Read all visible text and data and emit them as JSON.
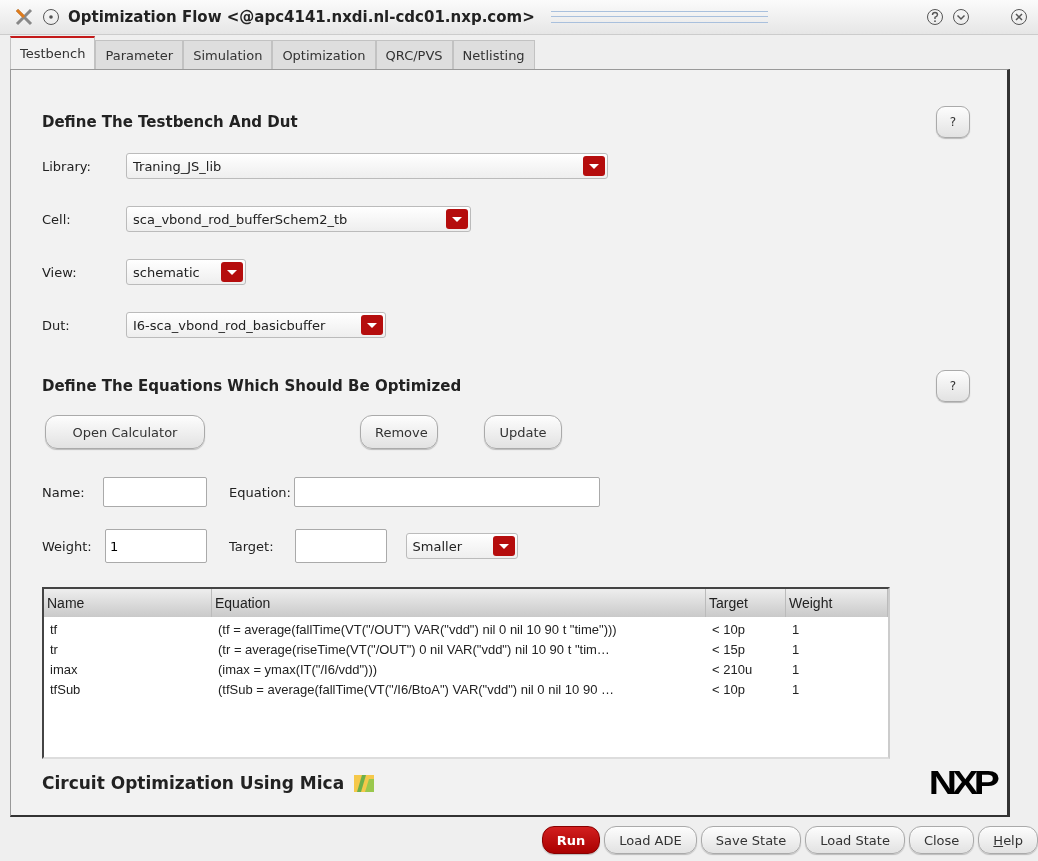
{
  "window": {
    "title": "Optimization Flow <@apc4141.nxdi.nl-cdc01.nxp.com>"
  },
  "tabs": [
    {
      "label": "Testbench",
      "selected": true
    },
    {
      "label": "Parameter",
      "selected": false
    },
    {
      "label": "Simulation",
      "selected": false
    },
    {
      "label": "Optimization",
      "selected": false
    },
    {
      "label": "QRC/PVS",
      "selected": false
    },
    {
      "label": "Netlisting",
      "selected": false
    }
  ],
  "testbench_section": {
    "title": "Define The Testbench And Dut",
    "help": "?",
    "fields": [
      {
        "label": "Library:",
        "value": "Traning_JS_lib"
      },
      {
        "label": "Cell:",
        "value": "sca_vbond_rod_bufferSchem2_tb"
      },
      {
        "label": "View:",
        "value": "schematic"
      },
      {
        "label": "Dut:",
        "value": "I6-sca_vbond_rod_basicbuffer"
      }
    ]
  },
  "equations_section": {
    "title": "Define The Equations Which Should Be Optimized",
    "help": "?",
    "buttons": [
      "Open Calculator",
      "Remove",
      "Update"
    ],
    "name": {
      "label": "Name:"
    },
    "equation": {
      "label": "Equation:"
    },
    "weight": {
      "label": "Weight:",
      "value": "1"
    },
    "target": {
      "label": "Target:"
    },
    "direction": {
      "value": "Smaller"
    }
  },
  "table": {
    "columns": [
      "Name",
      "Equation",
      "Target",
      "Weight"
    ],
    "rows": [
      [
        "tf",
        "(tf = average(fallTime(VT(\"/OUT\") VAR(\"vdd\") nil 0 nil 10 90 t \"time\")))",
        "< 10p",
        "1"
      ],
      [
        "tr",
        "(tr = average(riseTime(VT(\"/OUT\") 0 nil VAR(\"vdd\") nil 10 90 t \"tim…",
        "< 15p",
        "1"
      ],
      [
        "imax",
        "(imax = ymax(IT(\"/I6/vdd\")))",
        "< 210u",
        "1"
      ],
      [
        "tfSub",
        "(tfSub = average(fallTime(VT(\"/I6/BtoA\") VAR(\"vdd\") nil 0 nil 10 90 …",
        "< 10p",
        "1"
      ]
    ]
  },
  "footer": {
    "title": "Circuit Optimization Using Mica",
    "logo": "NXP"
  },
  "buttons": [
    {
      "label": "Run",
      "kind": "primary"
    },
    {
      "label": "Load ADE",
      "kind": "normal"
    },
    {
      "label": "Save State",
      "kind": "normal"
    },
    {
      "label": "Load State",
      "kind": "normal"
    },
    {
      "label": "Close",
      "kind": "normal"
    },
    {
      "label": "Help",
      "kind": "normal"
    }
  ]
}
